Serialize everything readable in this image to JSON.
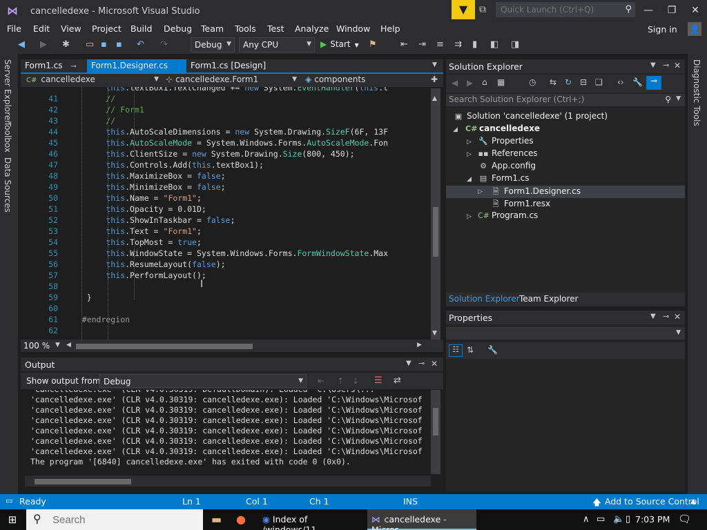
{
  "window": {
    "title": "cancelledexe - Microsoft Visual Studio",
    "quick_launch_placeholder": "Quick Launch (Ctrl+Q)"
  },
  "menu": [
    "File",
    "Edit",
    "View",
    "Project",
    "Build",
    "Debug",
    "Team",
    "Tools",
    "Test",
    "Analyze",
    "Window",
    "Help"
  ],
  "signin": "Sign in",
  "toolbar": {
    "config": "Debug",
    "platform": "Any CPU",
    "start": "Start"
  },
  "left_rail": [
    "Server Explorer",
    "Toolbox",
    "Data Sources"
  ],
  "right_rail": [
    "Diagnostic Tools"
  ],
  "doc_tabs": [
    {
      "label": "Form1.cs"
    },
    {
      "label": "Form1.Designer.cs"
    },
    {
      "label": "Form1.cs [Design]"
    }
  ],
  "nav": {
    "project": "cancelledexe",
    "class": "cancelledexe.Form1",
    "member": "components"
  },
  "code_lines": [
    {
      "n": "41",
      "text": "        //"
    },
    {
      "n": "42",
      "text": "        // Form1"
    },
    {
      "n": "43",
      "text": "        //"
    },
    {
      "n": "44",
      "text": "        this.AutoScaleDimensions = new System.Drawing.SizeF(6F, 13F"
    },
    {
      "n": "45",
      "text": "        this.AutoScaleMode = System.Windows.Forms.AutoScaleMode.Fon"
    },
    {
      "n": "46",
      "text": "        this.ClientSize = new System.Drawing.Size(800, 450);"
    },
    {
      "n": "47",
      "text": "        this.Controls.Add(this.textBox1);"
    },
    {
      "n": "48",
      "text": "        this.MaximizeBox = false;"
    },
    {
      "n": "49",
      "text": "        this.MinimizeBox = false;"
    },
    {
      "n": "50",
      "text": "        this.Name = \"Form1\";"
    },
    {
      "n": "51",
      "text": "        this.Opacity = 0.01D;"
    },
    {
      "n": "52",
      "text": "        this.ShowInTaskbar = false;"
    },
    {
      "n": "53",
      "text": "        this.Text = \"Form1\";"
    },
    {
      "n": "54",
      "text": "        this.TopMost = true;"
    },
    {
      "n": "55",
      "text": "        this.WindowState = System.Windows.Forms.FormWindowState.Max"
    },
    {
      "n": "56",
      "text": "        this.ResumeLayout(false);"
    },
    {
      "n": "57",
      "text": "        this.PerformLayout();"
    },
    {
      "n": "58",
      "text": ""
    },
    {
      "n": "59",
      "text": "    }"
    },
    {
      "n": "60",
      "text": ""
    },
    {
      "n": "61",
      "text": "   #endregion"
    },
    {
      "n": "62",
      "text": ""
    }
  ],
  "zoom": "100 %",
  "output": {
    "title": "Output",
    "show_from_label": "Show output from:",
    "show_from_value": "Debug",
    "lines": [
      "'cancelledexe.exe' (CLR v4.0.30319: cancelledexe.exe): Loaded 'C:\\Windows\\Microsof",
      "'cancelledexe.exe' (CLR v4.0.30319: cancelledexe.exe): Loaded 'C:\\Windows\\Microsof",
      "'cancelledexe.exe' (CLR v4.0.30319: cancelledexe.exe): Loaded 'C:\\Windows\\Microsof",
      "'cancelledexe.exe' (CLR v4.0.30319: cancelledexe.exe): Loaded 'C:\\Windows\\Microsof",
      "'cancelledexe.exe' (CLR v4.0.30319: cancelledexe.exe): Loaded 'C:\\Windows\\Microsof",
      "'cancelledexe.exe' (CLR v4.0.30319: cancelledexe.exe): Loaded 'C:\\Windows\\Microsof",
      "The program '[6840] cancelledexe.exe' has exited with code 0 (0x0)."
    ]
  },
  "solution_explorer": {
    "title": "Solution Explorer",
    "search_placeholder": "Search Solution Explorer (Ctrl+;)",
    "items": [
      {
        "label": "Solution 'cancelledexe' (1 project)",
        "icon": "solution-icon"
      },
      {
        "label": "cancelledexe",
        "icon": "csharp-project-icon"
      },
      {
        "label": "Properties",
        "icon": "wrench-icon"
      },
      {
        "label": "References",
        "icon": "references-icon"
      },
      {
        "label": "App.config",
        "icon": "config-icon"
      },
      {
        "label": "Form1.cs",
        "icon": "form-icon"
      },
      {
        "label": "Form1.Designer.cs",
        "icon": "file-icon"
      },
      {
        "label": "Form1.resx",
        "icon": "file-icon"
      },
      {
        "label": "Program.cs",
        "icon": "csharp-file-icon"
      }
    ],
    "tabs": [
      "Solution Explorer",
      "Team Explorer"
    ]
  },
  "properties": {
    "title": "Properties"
  },
  "status": {
    "ready": "Ready",
    "ln": "Ln 1",
    "col": "Col 1",
    "ch": "Ch 1",
    "ins": "INS",
    "source_control": "Add to Source Control"
  },
  "taskbar": {
    "search_placeholder": "Search",
    "apps": [
      "Index of /windows/11...",
      "cancelledexe - Micros..."
    ],
    "time": "7:03 PM"
  },
  "colors": {
    "accent": "#007acc",
    "keyword": "#569cd6",
    "type": "#4ec9b0",
    "string": "#d69d85",
    "comment": "#57a64a",
    "line_number": "#2b91af"
  }
}
